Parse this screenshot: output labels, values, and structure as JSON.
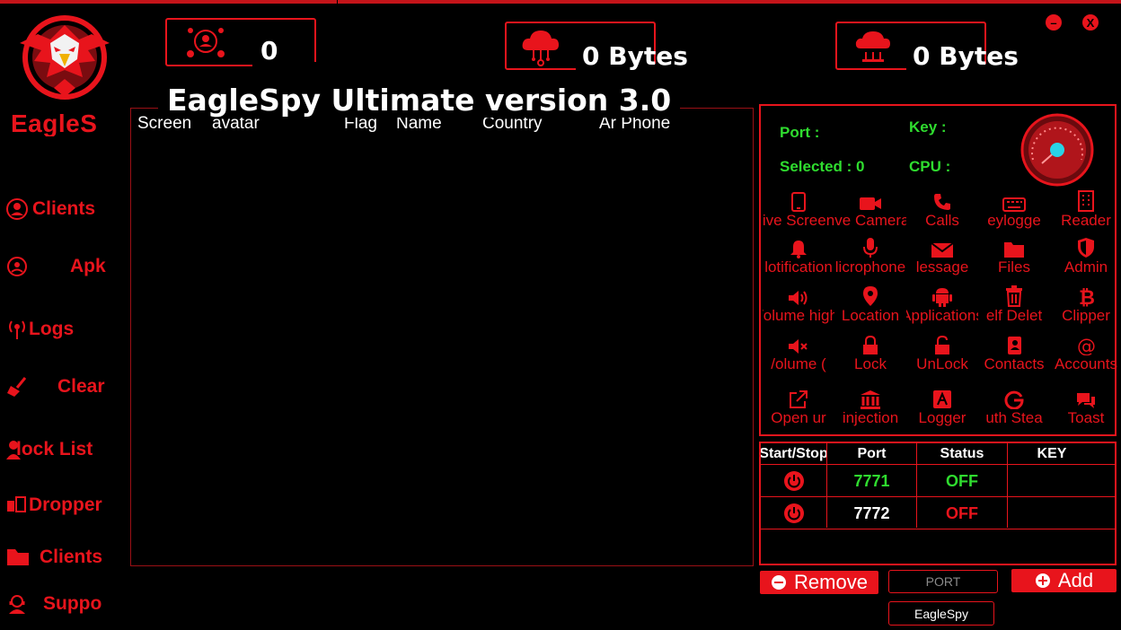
{
  "brand": {
    "name": "EagleS"
  },
  "title": "EagleSpy Ultimate version 3.0",
  "stats": {
    "clients": "0",
    "upload": "0 Bytes",
    "download": "0 Bytes"
  },
  "window": {
    "minimize": "–",
    "close": "X"
  },
  "sidebar": {
    "items": [
      {
        "label": "Clients",
        "icon": "user-circle-icon"
      },
      {
        "label": "Apk",
        "icon": "apk-icon"
      },
      {
        "label": "Logs",
        "icon": "broadcast-icon"
      },
      {
        "label": "Clear",
        "icon": "broom-icon"
      },
      {
        "label": "lock List",
        "icon": "user-lock-icon"
      },
      {
        "label": "Dropper",
        "icon": "dropper-icon"
      },
      {
        "label": "Clients",
        "icon": "folder-icon"
      },
      {
        "label": "Suppo",
        "icon": "support-icon"
      }
    ]
  },
  "list": {
    "columns": [
      "Screen",
      "avatar",
      "Flag",
      "Name",
      "Country",
      "Ar Phone"
    ]
  },
  "info": {
    "port_label": "Port :",
    "key_label": "Key :",
    "selected_label": "Selected : 0",
    "cpu_label": "CPU :"
  },
  "tools": [
    {
      "label": "ive Screen",
      "icon": "phone-icon"
    },
    {
      "label": "ive Camera",
      "icon": "camera-icon"
    },
    {
      "label": "Calls",
      "icon": "call-icon"
    },
    {
      "label": "eylogge",
      "icon": "keyboard-icon"
    },
    {
      "label": "Reader",
      "icon": "building-icon"
    },
    {
      "label": "lotification",
      "icon": "bell-icon"
    },
    {
      "label": "licrophone",
      "icon": "microphone-icon"
    },
    {
      "label": "lessage",
      "icon": "envelope-icon"
    },
    {
      "label": "Files",
      "icon": "folder-icon"
    },
    {
      "label": "Admin",
      "icon": "shield-icon"
    },
    {
      "label": "/olume high",
      "icon": "volume-high-icon"
    },
    {
      "label": "Location",
      "icon": "location-pin-icon"
    },
    {
      "label": "Applications",
      "icon": "android-icon"
    },
    {
      "label": "elf Delet",
      "icon": "trash-icon"
    },
    {
      "label": "Clipper",
      "icon": "bitcoin-icon"
    },
    {
      "label": "/olume (",
      "icon": "volume-mute-icon"
    },
    {
      "label": "Lock",
      "icon": "lock-icon"
    },
    {
      "label": "UnLock",
      "icon": "unlock-icon"
    },
    {
      "label": "Contacts",
      "icon": "contact-book-icon"
    },
    {
      "label": "Accounts",
      "icon": "at-icon"
    },
    {
      "label": "Open ur",
      "icon": "external-link-icon"
    },
    {
      "label": "injection",
      "icon": "bank-icon"
    },
    {
      "label": "Logger",
      "icon": "logger-icon"
    },
    {
      "label": "uth Stea",
      "icon": "google-icon"
    },
    {
      "label": "Toast",
      "icon": "chat-icon"
    }
  ],
  "ports": {
    "headers": [
      "Start/Stop",
      "Port",
      "Status",
      "KEY"
    ],
    "rows": [
      {
        "port": "7771",
        "status": "OFF",
        "key": ""
      },
      {
        "port": "7772",
        "status": "OFF",
        "key": ""
      }
    ]
  },
  "actions": {
    "remove": "Remove",
    "add": "Add",
    "port_placeholder": "PORT",
    "name_button": "EagleSpy"
  },
  "colors": {
    "accent": "#e8141c",
    "ok": "#2fdc2f",
    "bg": "#000000"
  }
}
